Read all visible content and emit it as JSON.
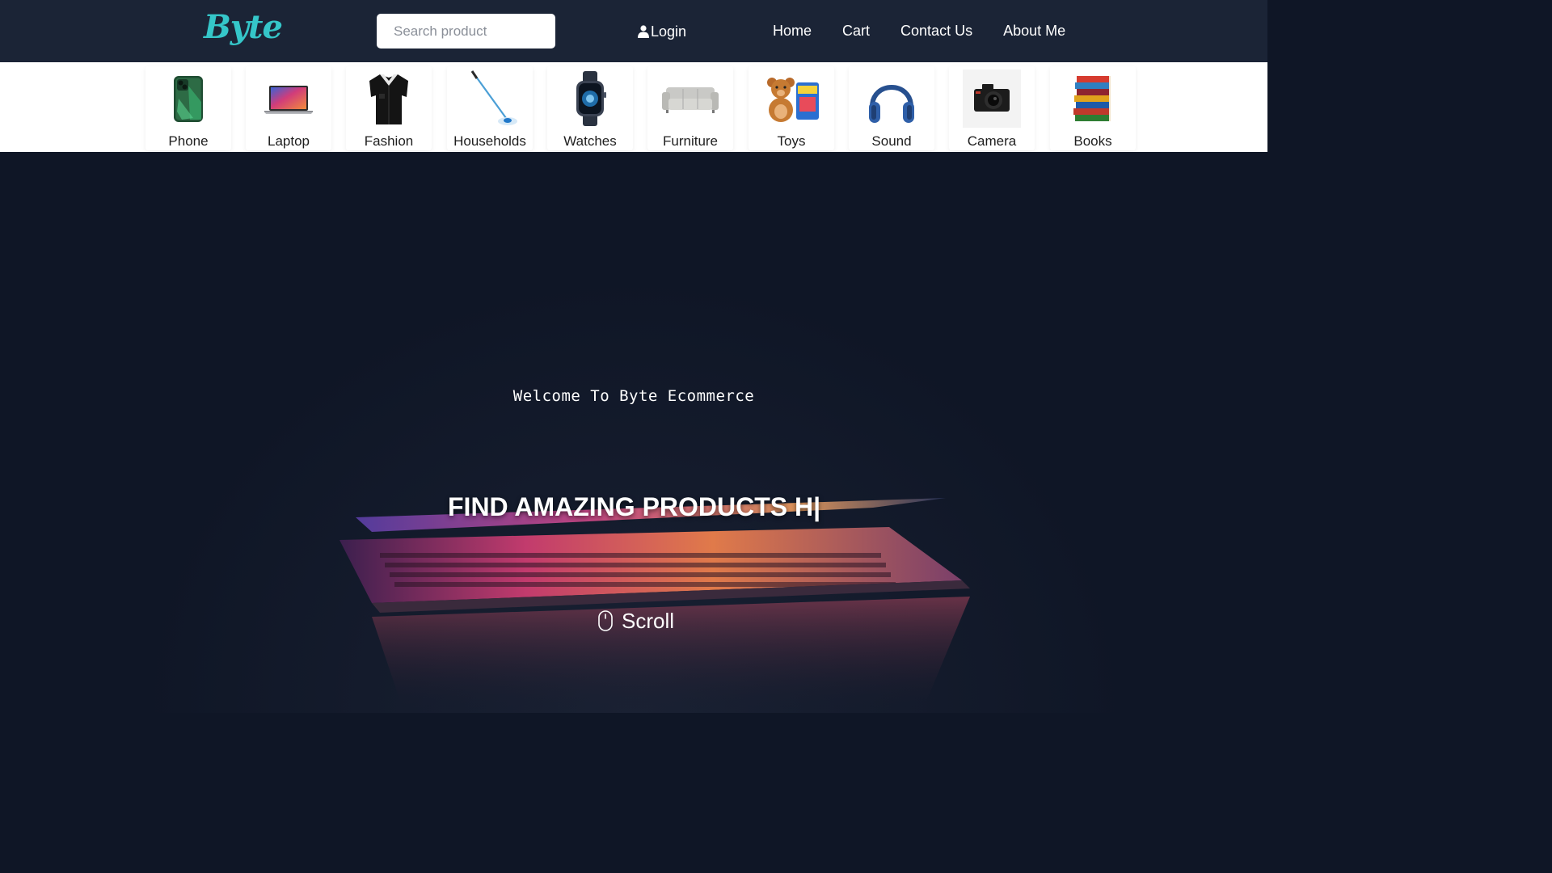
{
  "header": {
    "logo": "Byte",
    "search": {
      "placeholder": "Search product",
      "value": ""
    },
    "login": {
      "label": "Login",
      "icon": "user-icon"
    },
    "nav": [
      {
        "label": "Home"
      },
      {
        "label": "Cart"
      },
      {
        "label": "Contact Us"
      },
      {
        "label": "About Me"
      }
    ]
  },
  "categories": [
    {
      "label": "Phone",
      "icon": "phone-image"
    },
    {
      "label": "Laptop",
      "icon": "laptop-image"
    },
    {
      "label": "Fashion",
      "icon": "shirt-image"
    },
    {
      "label": "Households",
      "icon": "mop-image"
    },
    {
      "label": "Watches",
      "icon": "smartwatch-image"
    },
    {
      "label": "Furniture",
      "icon": "sofa-image"
    },
    {
      "label": "Toys",
      "icon": "teddy-bear-image"
    },
    {
      "label": "Sound",
      "icon": "headphones-image"
    },
    {
      "label": "Camera",
      "icon": "camera-image"
    },
    {
      "label": "Books",
      "icon": "books-image"
    }
  ],
  "hero": {
    "welcome": "Welcome To Byte Ecommerce",
    "headline": "FIND AMAZING PRODUCTS H|",
    "scroll": {
      "label": "Scroll",
      "icon": "mouse-icon"
    }
  },
  "colors": {
    "header_bg": "#1b2436",
    "brand": "#35c6c9",
    "hero_bg": "#0f1626",
    "category_bg": "#ffffff"
  }
}
